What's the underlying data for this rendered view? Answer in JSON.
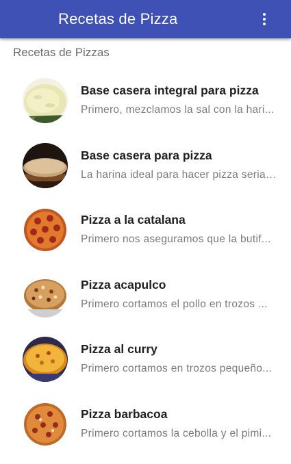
{
  "appbar": {
    "title": "Recetas de Pizza",
    "menu_icon": "more-vert-icon"
  },
  "section_title": "Recetas de Pizzas",
  "recipes": [
    {
      "title": "Base casera integral para pizza",
      "description": "Primero, mezclamos la sal con la hari...",
      "thumb_icon": "pizza-dough-image"
    },
    {
      "title": "Base casera para pizza",
      "description": "La harina ideal para hacer pizza seria ...",
      "thumb_icon": "pizza-base-image"
    },
    {
      "title": "Pizza a la catalana",
      "description": "Primero nos aseguramos que la butif...",
      "thumb_icon": "pepperoni-pizza-image"
    },
    {
      "title": "Pizza acapulco",
      "description": "Primero cortamos el pollo en trozos ...",
      "thumb_icon": "chicken-pizza-image"
    },
    {
      "title": "Pizza al curry",
      "description": "Primero cortamos en trozos pequeño...",
      "thumb_icon": "curry-pizza-image"
    },
    {
      "title": "Pizza barbacoa",
      "description": "Primero cortamos la cebolla y el pimi...",
      "thumb_icon": "bbq-pizza-image"
    }
  ],
  "colors": {
    "appbar": "#3f51b5",
    "title_text": "#1f1f1f",
    "subtitle_text": "#7a7a7a"
  }
}
